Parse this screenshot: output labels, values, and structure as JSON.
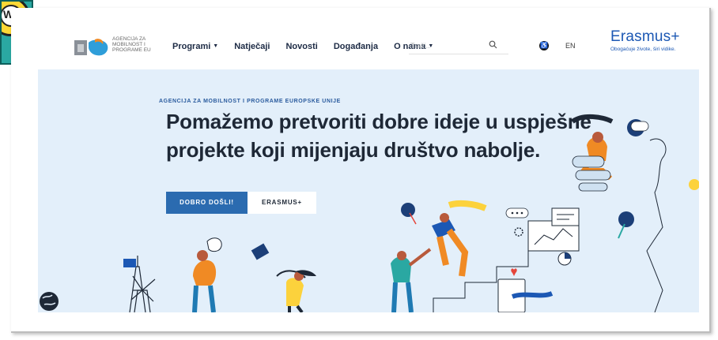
{
  "header": {
    "logo_text": [
      "AGENCIJA ZA",
      "MOBILNOST I",
      "PROGRAME EU"
    ],
    "nav": [
      {
        "label": "Programi",
        "dropdown": true
      },
      {
        "label": "Natječaji",
        "dropdown": false
      },
      {
        "label": "Novosti",
        "dropdown": false
      },
      {
        "label": "Događanja",
        "dropdown": false
      },
      {
        "label": "O nama",
        "dropdown": true
      }
    ],
    "search": {
      "placeholder": "Traži..",
      "icon": "search-icon"
    },
    "accessibility_icon": "accessibility-icon",
    "language": "EN",
    "erasmus": {
      "brand": "Erasmus+",
      "tagline": "Obogaćuje živote, širi vidike."
    }
  },
  "hero": {
    "overline": "AGENCIJA ZA MOBILNOST I PROGRAME EUROPSKE UNIJE",
    "headline_line1": "Pomažemo pretvoriti dobre ideje u uspješne",
    "headline_line2": "projekte koji mijenjaju društvo nabolje.",
    "primary_button": "DOBRO DOŠLI!",
    "secondary_button": "ERASMUS+"
  },
  "colors": {
    "hero_bg": "#e3effa",
    "primary": "#2b6bb0",
    "brand_blue": "#1c58b4",
    "heading": "#1e2836",
    "accent_orange": "#f08a24",
    "accent_yellow": "#fcd23c"
  }
}
